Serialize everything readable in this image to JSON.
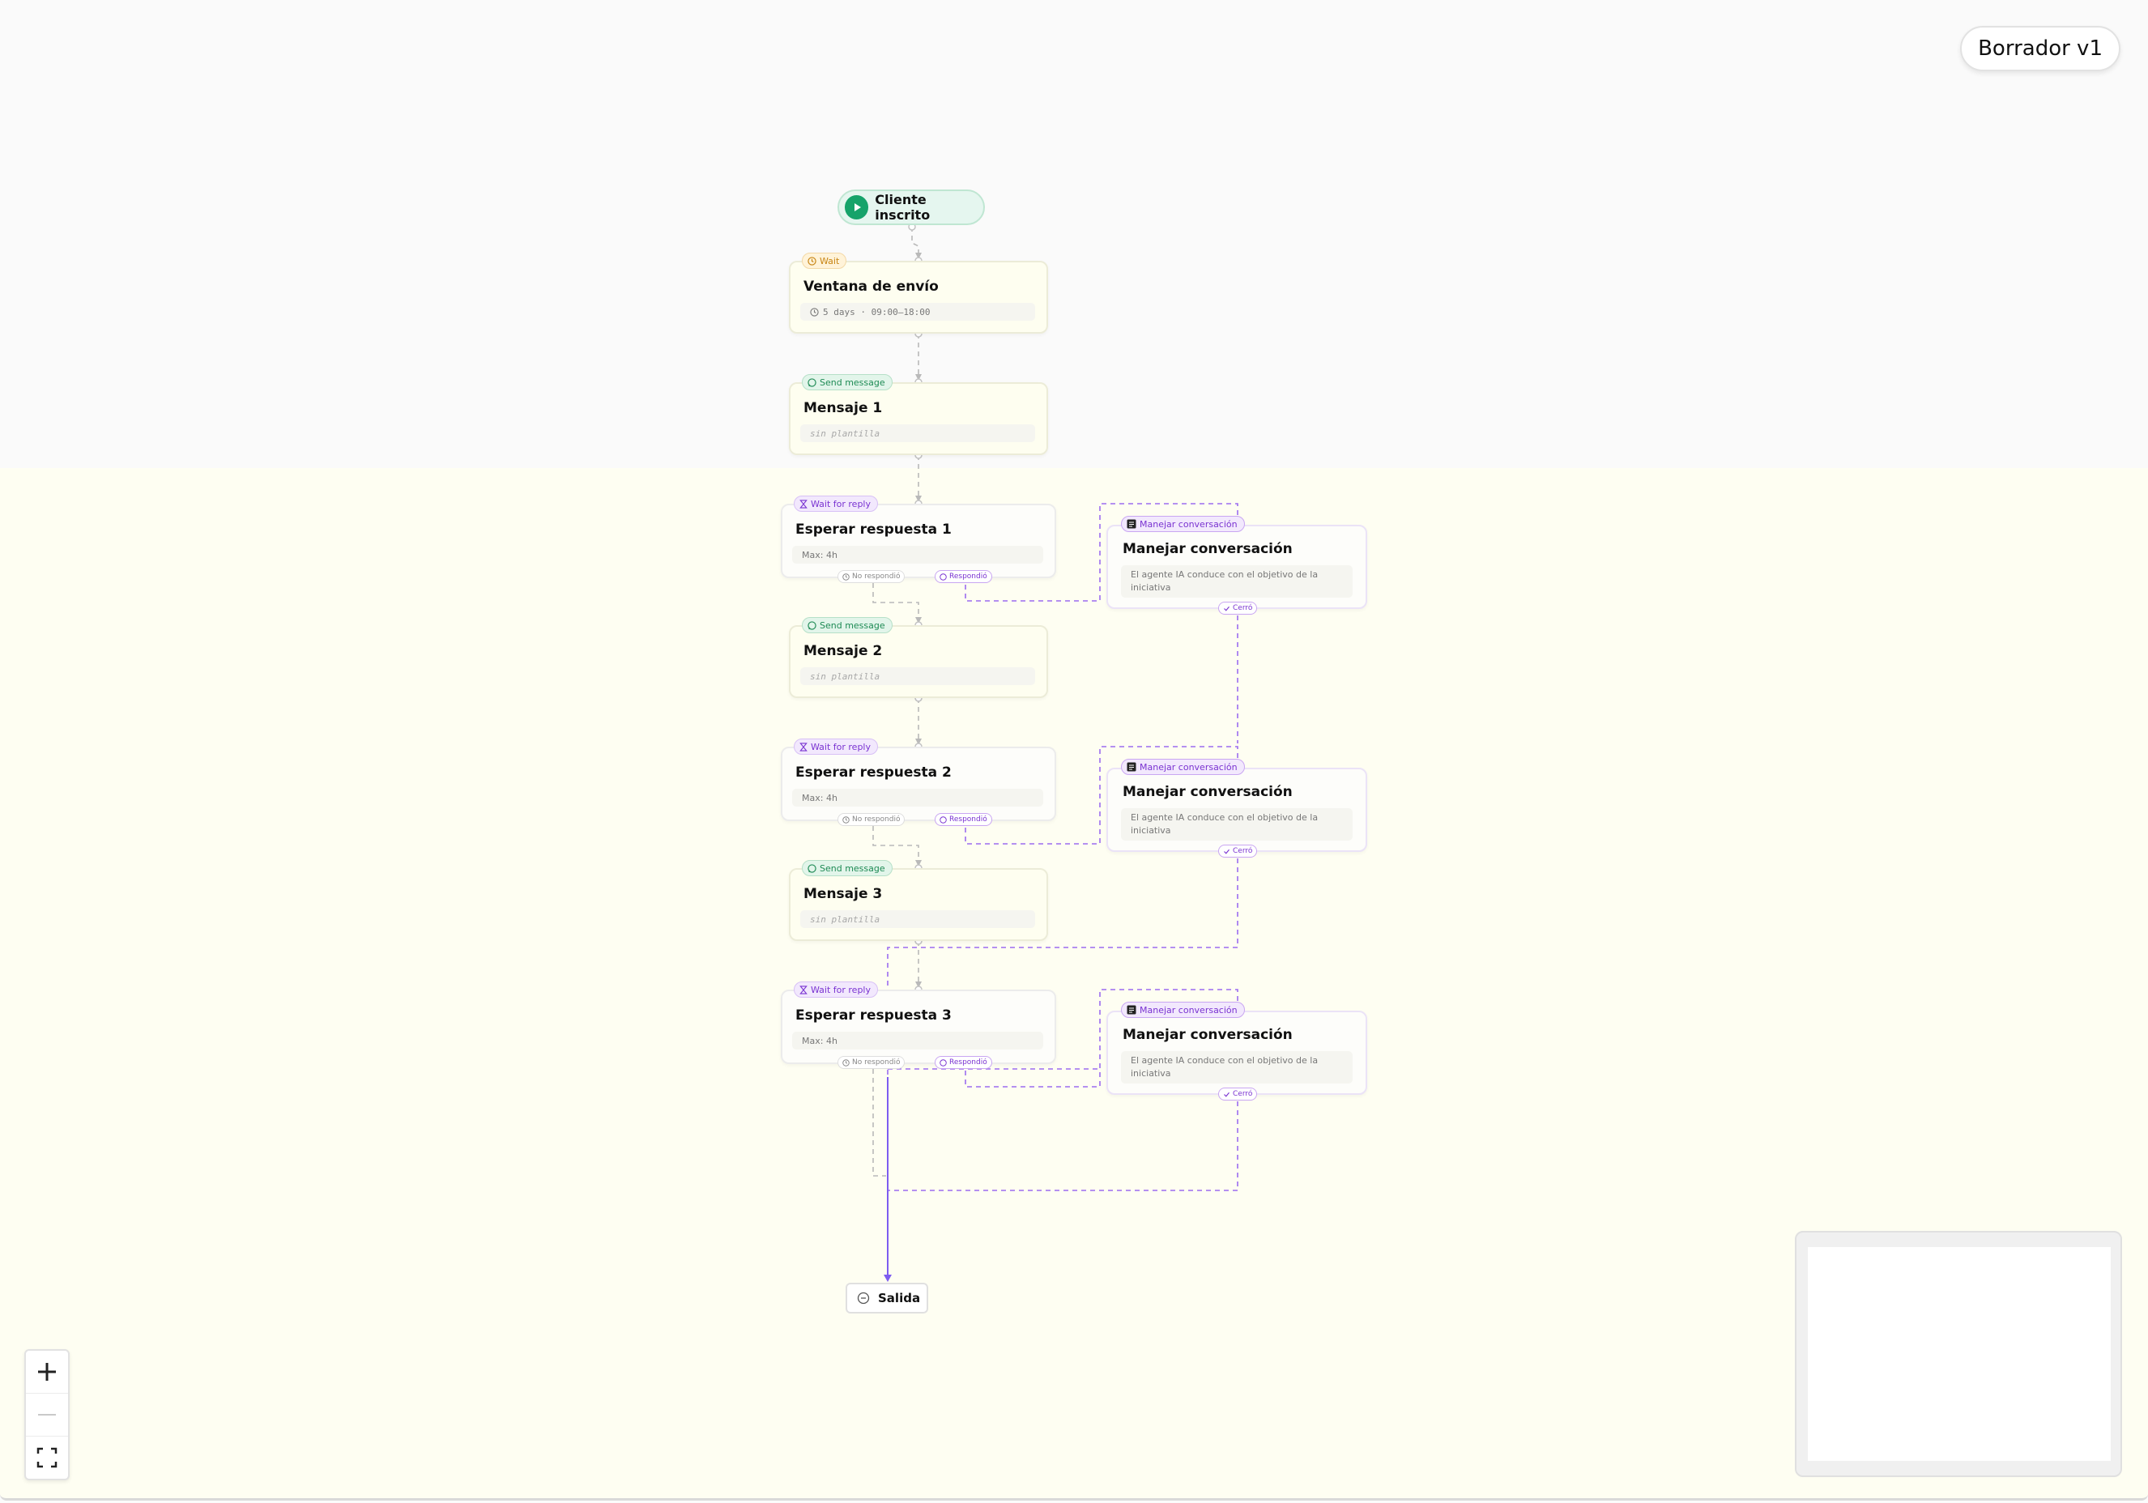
{
  "header": {
    "draft_label": "Borrador v1"
  },
  "trigger": {
    "label": "Cliente inscrito"
  },
  "nodes": {
    "window": {
      "badge": "Wait",
      "title": "Ventana de envío",
      "detail": "5 days · 09:00–18:00"
    },
    "msg1": {
      "badge": "Send message",
      "title": "Mensaje 1",
      "detail": "sin plantilla"
    },
    "wait1": {
      "badge": "Wait for reply",
      "title": "Esperar respuesta 1",
      "detail": "Max: 4h",
      "no_reply": "No respondió",
      "replied": "Respondió"
    },
    "manage1": {
      "badge": "Manejar conversación",
      "title": "Manejar conversación",
      "detail": "El agente IA conduce con el objetivo de la iniciativa",
      "closed": "Cerró"
    },
    "msg2": {
      "badge": "Send message",
      "title": "Mensaje 2",
      "detail": "sin plantilla"
    },
    "wait2": {
      "badge": "Wait for reply",
      "title": "Esperar respuesta 2",
      "detail": "Max: 4h",
      "no_reply": "No respondió",
      "replied": "Respondió"
    },
    "manage2": {
      "badge": "Manejar conversación",
      "title": "Manejar conversación",
      "detail": "El agente IA conduce con el objetivo de la iniciativa",
      "closed": "Cerró"
    },
    "msg3": {
      "badge": "Send message",
      "title": "Mensaje 3",
      "detail": "sin plantilla"
    },
    "wait3": {
      "badge": "Wait for reply",
      "title": "Esperar respuesta 3",
      "detail": "Max: 4h",
      "no_reply": "No respondió",
      "replied": "Respondió"
    },
    "manage3": {
      "badge": "Manejar conversación",
      "title": "Manejar conversación",
      "detail": "El agente IA conduce con el objetivo de la iniciativa",
      "closed": "Cerró"
    }
  },
  "exit": {
    "label": "Salida"
  },
  "controls": {
    "zoom_in_icon": "plus-icon",
    "zoom_out_icon": "minus-icon",
    "fit_icon": "fit-view-icon"
  },
  "colors": {
    "accent_purple": "#8b5cf6",
    "edge_gray": "#b9b9b9",
    "trigger_green": "#16a36a",
    "wait_orange": "#c78412"
  }
}
